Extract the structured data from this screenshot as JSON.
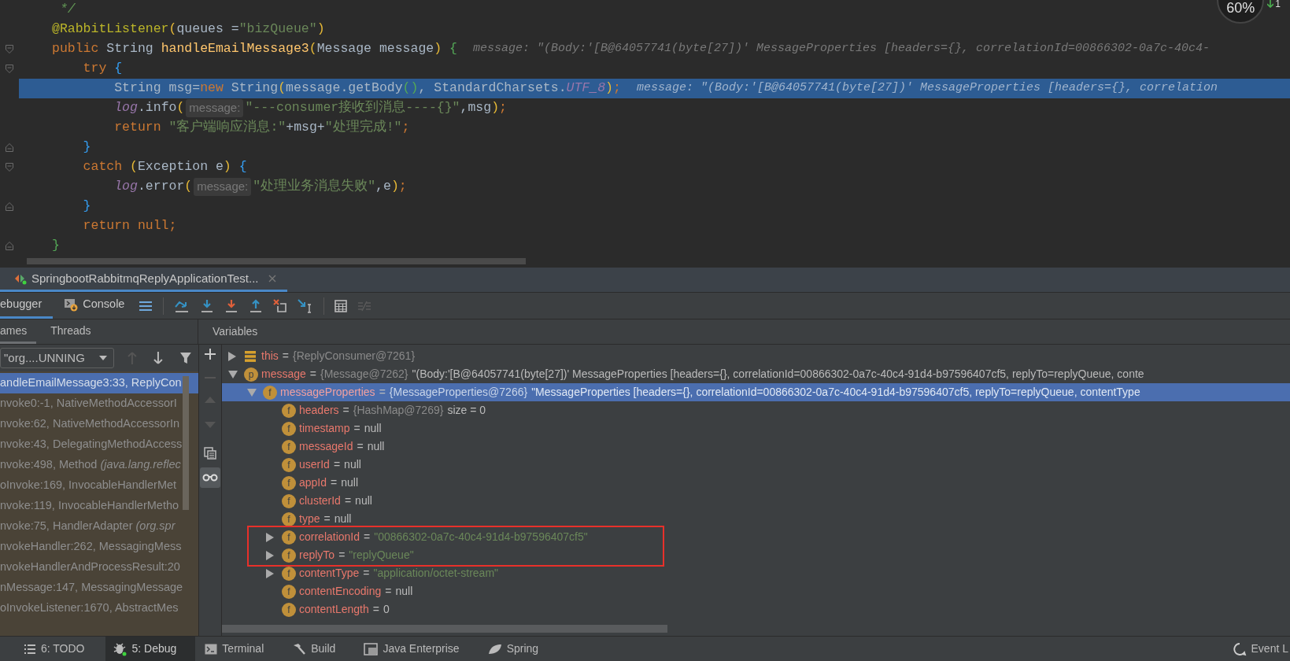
{
  "editor": {
    "lines": [
      {
        "tokens": [
          {
            "kind": "comment",
            "text": " */"
          }
        ]
      },
      {
        "tokens": [
          {
            "kind": "ann",
            "text": "@RabbitListener"
          },
          {
            "kind": "b1",
            "text": "("
          },
          {
            "kind": "plain",
            "text": "queues ="
          },
          {
            "kind": "str",
            "text": "\"bizQueue\""
          },
          {
            "kind": "b1",
            "text": ")"
          }
        ]
      },
      {
        "fold_start": true,
        "tokens": [
          {
            "kind": "kw",
            "text": "public"
          },
          {
            "kind": "plain",
            "text": " String "
          },
          {
            "kind": "method",
            "text": "handleEmailMessage3"
          },
          {
            "kind": "b1",
            "text": "("
          },
          {
            "kind": "plain",
            "text": "Message message"
          },
          {
            "kind": "b1",
            "text": ")"
          },
          {
            "kind": "b2",
            "text": " {"
          }
        ],
        "inline_value": "message: \"(Body:'[B@64057741(byte[27])' MessageProperties [headers={}, correlationId=00866302-0a7c-40c4-"
      },
      {
        "fold_start": true,
        "tokens": [
          {
            "kind": "kw",
            "text": "    try "
          },
          {
            "kind": "b3",
            "text": "{"
          }
        ]
      },
      {
        "current": true,
        "tokens": [
          {
            "kind": "plain",
            "text": "        String msg="
          },
          {
            "kind": "kw",
            "text": "new"
          },
          {
            "kind": "plain",
            "text": " String"
          },
          {
            "kind": "b1",
            "text": "("
          },
          {
            "kind": "plain",
            "text": "message.getBody"
          },
          {
            "kind": "b2",
            "text": "()"
          },
          {
            "kind": "plain",
            "text": ", StandardCharsets."
          },
          {
            "kind": "static",
            "text": "UTF_8"
          },
          {
            "kind": "b1",
            "text": ")"
          },
          {
            "kind": "kw",
            "text": ";"
          }
        ],
        "inline_value": "message: \"(Body:'[B@64057741(byte[27])' MessageProperties [headers={}, correlation"
      },
      {
        "tokens": [
          {
            "kind": "static",
            "text": "        log"
          },
          {
            "kind": "plain",
            "text": ".info"
          },
          {
            "kind": "b1",
            "text": "("
          },
          {
            "kind": "hint",
            "text": "message:"
          },
          {
            "kind": "str",
            "text": "\"---consumer接收到消息----{}\""
          },
          {
            "kind": "plain",
            "text": ",msg"
          },
          {
            "kind": "b1",
            "text": ")"
          },
          {
            "kind": "kw",
            "text": ";"
          }
        ]
      },
      {
        "tokens": [
          {
            "kind": "kw",
            "text": "        return "
          },
          {
            "kind": "str",
            "text": "\"客户端响应消息:\""
          },
          {
            "kind": "plain",
            "text": "+msg+"
          },
          {
            "kind": "str",
            "text": "\"处理完成!\""
          },
          {
            "kind": "kw",
            "text": ";"
          }
        ]
      },
      {
        "fold_end": true,
        "tokens": [
          {
            "kind": "b3",
            "text": "    }"
          }
        ]
      },
      {
        "fold_start": true,
        "tokens": [
          {
            "kind": "kw",
            "text": "    catch "
          },
          {
            "kind": "b1",
            "text": "("
          },
          {
            "kind": "plain",
            "text": "Exception e"
          },
          {
            "kind": "b1",
            "text": ")"
          },
          {
            "kind": "b3",
            "text": " {"
          }
        ]
      },
      {
        "tokens": [
          {
            "kind": "static",
            "text": "        log"
          },
          {
            "kind": "plain",
            "text": ".error"
          },
          {
            "kind": "b1",
            "text": "("
          },
          {
            "kind": "hint",
            "text": "message:"
          },
          {
            "kind": "str",
            "text": "\"处理业务消息失败\""
          },
          {
            "kind": "plain",
            "text": ",e"
          },
          {
            "kind": "b1",
            "text": ")"
          },
          {
            "kind": "kw",
            "text": ";"
          }
        ]
      },
      {
        "fold_end": true,
        "tokens": [
          {
            "kind": "b3",
            "text": "    }"
          }
        ]
      },
      {
        "tokens": [
          {
            "kind": "kw",
            "text": "    return null;"
          }
        ]
      },
      {
        "fold_end": true,
        "tokens": [
          {
            "kind": "b2",
            "text": "}"
          }
        ]
      }
    ],
    "memory_indicator": {
      "text": "60%",
      "badge": "1"
    }
  },
  "run_tabs": [
    {
      "label": "SpringbootRabbitmqReplyApplicationTest...",
      "selected": true
    }
  ],
  "debug_tabs": [
    {
      "label": "ebugger",
      "selected": true
    },
    {
      "label": "Console",
      "selected": false
    }
  ],
  "frames_tabs": [
    {
      "label": "ames",
      "selected": true
    },
    {
      "label": "Threads",
      "selected": false
    }
  ],
  "variables_title": "Variables",
  "thread_selector": {
    "value": "\"org....UNNING"
  },
  "frames": [
    {
      "text": "andleEmailMessage3:33, ReplyCon",
      "selected": true
    },
    {
      "text": "nvoke0:-1, NativeMethodAccessorI",
      "selected": false
    },
    {
      "text": "nvoke:62, NativeMethodAccessorIn",
      "selected": false
    },
    {
      "text": "nvoke:43, DelegatingMethodAccess",
      "selected": false
    },
    {
      "text": "nvoke:498, Method *(java.lang.reflec*",
      "selected": false
    },
    {
      "text": "oInvoke:169, InvocableHandlerMet",
      "selected": false
    },
    {
      "text": "nvoke:119, InvocableHandlerMetho",
      "selected": false
    },
    {
      "text": "nvoke:75, HandlerAdapter *(org.spr*",
      "selected": false
    },
    {
      "text": "nvokeHandler:262, MessagingMess",
      "selected": false
    },
    {
      "text": "nvokeHandlerAndProcessResult:20",
      "selected": false
    },
    {
      "text": "nMessage:147, MessagingMessage",
      "selected": false
    },
    {
      "text": "oInvokeListener:1670, AbstractMes",
      "selected": false
    }
  ],
  "variables": [
    {
      "kind": "this",
      "name": "this",
      "sign": "=",
      "type": "{ReplyConsumer@7261}",
      "expanded": false,
      "selected": false
    },
    {
      "kind": "param",
      "icon": "p",
      "name": "message",
      "sign": "=",
      "type": "{Message@7262}",
      "value": "\"(Body:'[B@64057741(byte[27])' MessageProperties [headers={}, correlationId=00866302-0a7c-40c4-91d4-b97596407cf5, replyTo=replyQueue, conte",
      "is_string": false,
      "expanded": true,
      "selected": false,
      "children": [
        {
          "kind": "field",
          "icon": "f",
          "name": "messageProperties",
          "sign": "=",
          "type": "{MessageProperties@7266}",
          "value": "\"MessageProperties [headers={}, correlationId=00866302-0a7c-40c4-91d4-b97596407cf5, replyTo=replyQueue, contentType",
          "is_string": false,
          "expanded": true,
          "selected": true,
          "children": [
            {
              "kind": "field",
              "icon": "f",
              "name": "headers",
              "sign": "=",
              "type": "{HashMap@7269}",
              "value": "size = 0",
              "is_string": false,
              "selected": false,
              "highlighted": false
            },
            {
              "kind": "field",
              "icon": "f",
              "name": "timestamp",
              "sign": "=",
              "value": "null",
              "is_string": false,
              "selected": false,
              "highlighted": false
            },
            {
              "kind": "field",
              "icon": "f",
              "name": "messageId",
              "sign": "=",
              "value": "null",
              "is_string": false,
              "selected": false,
              "highlighted": false
            },
            {
              "kind": "field",
              "icon": "f",
              "name": "userId",
              "sign": "=",
              "value": "null",
              "is_string": false,
              "selected": false,
              "highlighted": false
            },
            {
              "kind": "field",
              "icon": "f",
              "name": "appId",
              "sign": "=",
              "value": "null",
              "is_string": false,
              "selected": false,
              "highlighted": false
            },
            {
              "kind": "field",
              "icon": "f",
              "name": "clusterId",
              "sign": "=",
              "value": "null",
              "is_string": false,
              "selected": false,
              "highlighted": false
            },
            {
              "kind": "field",
              "icon": "f",
              "name": "type",
              "sign": "=",
              "value": "null",
              "is_string": false,
              "selected": false,
              "highlighted": false
            },
            {
              "kind": "field",
              "icon": "f",
              "name": "correlationId",
              "sign": "=",
              "value": "\"00866302-0a7c-40c4-91d4-b97596407cf5\"",
              "is_string": true,
              "expanded": false,
              "selected": false,
              "highlighted": true
            },
            {
              "kind": "field",
              "icon": "f",
              "name": "replyTo",
              "sign": "=",
              "value": "\"replyQueue\"",
              "is_string": true,
              "expanded": false,
              "selected": false,
              "highlighted": true
            },
            {
              "kind": "field",
              "icon": "f",
              "name": "contentType",
              "sign": "=",
              "value": "\"application/octet-stream\"",
              "is_string": true,
              "expanded": false,
              "selected": false,
              "highlighted": false
            },
            {
              "kind": "field",
              "icon": "f",
              "name": "contentEncoding",
              "sign": "=",
              "value": "null",
              "is_string": false,
              "selected": false,
              "highlighted": false
            },
            {
              "kind": "field",
              "icon": "f",
              "name": "contentLength",
              "sign": "=",
              "value": "0",
              "is_string": false,
              "selected": false,
              "highlighted": false
            }
          ]
        }
      ]
    }
  ],
  "tool_windows": [
    {
      "kind": "todo",
      "label": "6: TODO",
      "selected": false
    },
    {
      "kind": "debug",
      "label": "5: Debug",
      "selected": true
    },
    {
      "kind": "terminal",
      "label": "Terminal",
      "selected": false
    },
    {
      "kind": "build",
      "label": "Build",
      "selected": false
    },
    {
      "kind": "enterprise",
      "label": "Java Enterprise",
      "selected": false
    },
    {
      "kind": "spring",
      "label": "Spring",
      "selected": false
    }
  ],
  "event_log": "Event L"
}
